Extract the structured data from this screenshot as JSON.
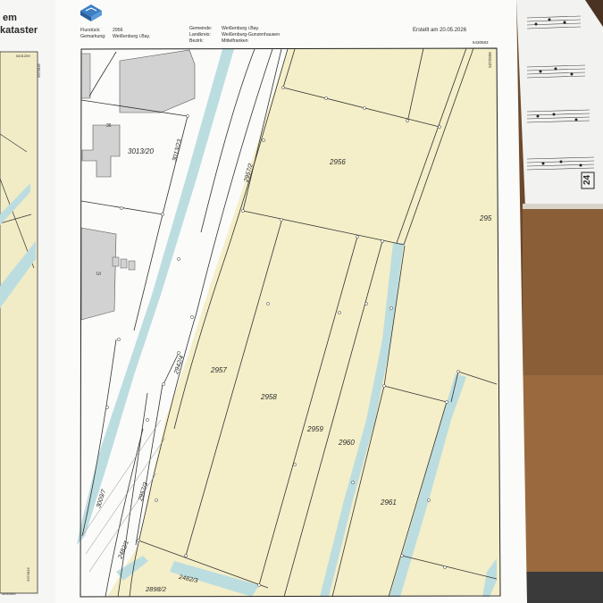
{
  "left_sheet": {
    "title_line1": "em",
    "title_line2": "kataster",
    "corner_top": "5431209",
    "corner_side": "5372845",
    "corner_bottom": "5430340",
    "corner_bottom_side": "5372816"
  },
  "header": {
    "flurstueck_label": "Flurstück:",
    "flurstueck_value": "2956",
    "gemarkung_label": "Gemarkung:",
    "gemarkung_value": "Weißenburg i.Bay.",
    "gemeinde_label": "Gemeinde:",
    "gemeinde_value": "Weißenburg i.Bay.",
    "landkreis_label": "Landkreis:",
    "landkreis_value": "Weißenburg-Gunzenhausen",
    "bezirk_label": "Bezirk:",
    "bezirk_value": "Mittelfranken",
    "created": "Erstellt am 20.05.2026",
    "corner_coord": "5430683",
    "corner_coord_side": "5372939"
  },
  "parcels": {
    "p2956": "2956",
    "p295": "295",
    "p2957": "2957",
    "p2958": "2958",
    "p2959": "2959",
    "p2960": "2960",
    "p2961": "2961",
    "p3013_20": "3013/20",
    "p3013_23": "3013/23",
    "p2957_2": "2957/2",
    "p2942_4": "2942/4",
    "p3009_7": "3009/7",
    "p2957_3": "2957/3",
    "p2482_1": "2482/1",
    "p2482_3": "2482/3",
    "p2898_2": "2898/2",
    "house_no": "36",
    "shed_label": "Ui"
  },
  "music": {
    "page_number": "24"
  },
  "colors": {
    "parcel_fill": "#f4efc8",
    "water": "#bcdde0",
    "building": "#d2d2d2",
    "paper": "#fbfbf9",
    "wood_dark": "#6d4a2c"
  }
}
